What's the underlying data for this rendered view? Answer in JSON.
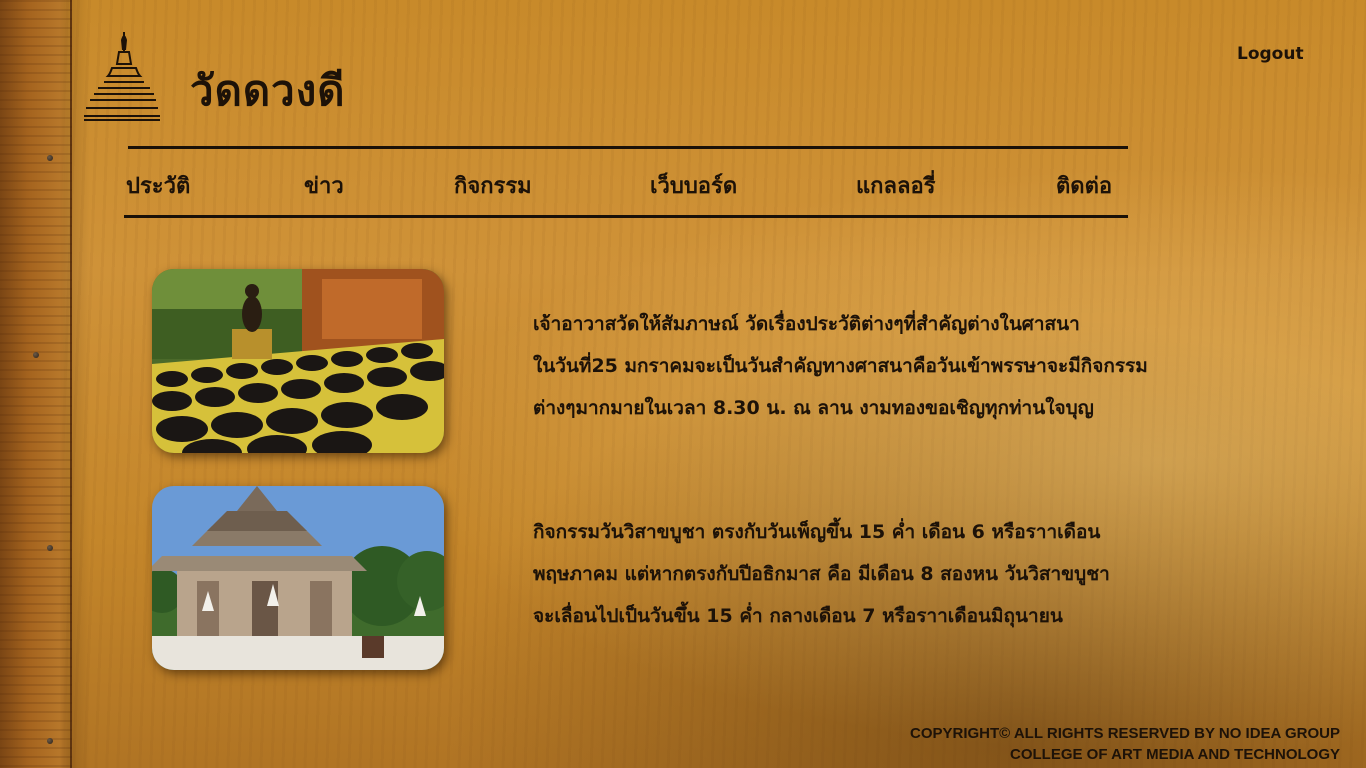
{
  "header": {
    "site_title": "วัดดวงดี",
    "logout_label": "Logout",
    "logo_icon": "pagoda-icon"
  },
  "nav": {
    "items": [
      {
        "label": "ประวัติ"
      },
      {
        "label": "ข่าว"
      },
      {
        "label": "กิจกรรม"
      },
      {
        "label": "เว็บบอร์ด"
      },
      {
        "label": "แกลลอรี่"
      },
      {
        "label": "ติดต่อ"
      }
    ]
  },
  "news": [
    {
      "image": "alms-bowls-photo",
      "lines": [
        "เจ้าอาวาสวัดให้สัมภาษณ์ วัดเรื่องประวัติต่างๆที่สำคัญต่างในศาสนา",
        "ในวันที่25 มกราคมจะเป็นวันสำคัญทางศาสนาคือวันเข้าพรรษาจะมีกิจกรรม",
        "ต่างๆมากมายในเวลา 8.30 น. ณ ลาน งามทองขอเชิญทุกท่านใจบุญ"
      ]
    },
    {
      "image": "temple-hall-photo",
      "lines": [
        "กิจกรรมวันวิสาขบูชา ตรงกับวันเพ็ญขึ้น 15 ค่ำ เดือน 6 หรือราาเดือน",
        "พฤษภาคม แต่หากตรงกับปีอธิกมาส คือ มีเดือน 8 สองหน วันวิสาขบูชา",
        "จะเลื่อนไปเป็นวันขึ้น 15 ค่ำ กลางเดือน 7 หรือราาเดือนมิถุนายน"
      ]
    }
  ],
  "footer": {
    "line1": "COPYRIGHT©  ALL RIGHTS RESERVED BY NO IDEA GROUP",
    "line2": "COLLEGE OF ART MEDIA AND TECHNOLOGY"
  }
}
